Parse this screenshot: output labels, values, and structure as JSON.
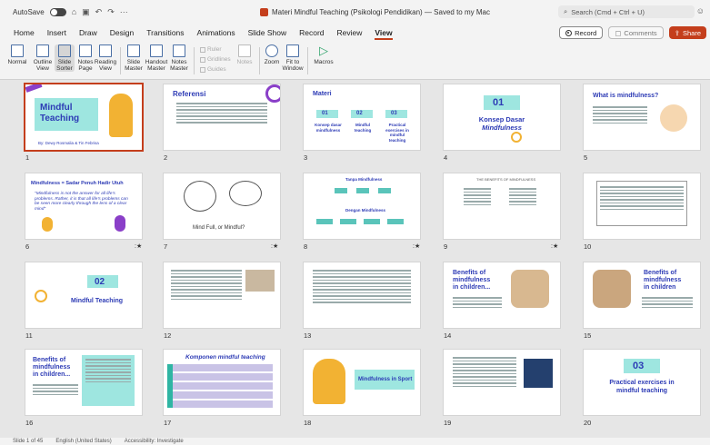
{
  "titlebar": {
    "autosave_label": "AutoSave",
    "document_title": "Materi Mindful Teaching (Psikologi Pendidikan) — Saved to my Mac",
    "search_placeholder": "Search (Cmd + Ctrl + U)"
  },
  "menu": {
    "tabs": [
      "Home",
      "Insert",
      "Draw",
      "Design",
      "Transitions",
      "Animations",
      "Slide Show",
      "Record",
      "Review",
      "View"
    ],
    "active_tab": "View",
    "record_label": "Record",
    "comments_label": "Comments",
    "share_label": "Share"
  },
  "ribbon": {
    "normal": "Normal",
    "outline_view": [
      "Outline",
      "View"
    ],
    "slide_sorter": [
      "Slide",
      "Sorter"
    ],
    "notes_page": [
      "Notes",
      "Page"
    ],
    "reading_view": [
      "Reading",
      "View"
    ],
    "slide_master": [
      "Slide",
      "Master"
    ],
    "handout_master": [
      "Handout",
      "Master"
    ],
    "notes_master": [
      "Notes",
      "Master"
    ],
    "ruler": "Ruler",
    "gridlines": "Gridlines",
    "guides": "Guides",
    "notes": "Notes",
    "zoom": "Zoom",
    "fit_to_window": [
      "Fit to",
      "Window"
    ],
    "macros": "Macros"
  },
  "slides": {
    "s1_title": [
      "Mindful",
      "Teaching"
    ],
    "s1_author": "By: Dewy Rosmalia & Tin Febrisa",
    "s2_title": "Referensi",
    "s3_title": "Materi",
    "s3_items": [
      "01",
      "02",
      "03"
    ],
    "s3_labels": [
      "Konsep dasar mindfulness",
      "Mindful teaching",
      "Practical exercises in mindful teaching"
    ],
    "s4_number": "01",
    "s4_title": [
      "Konsep Dasar",
      "Mindfulness"
    ],
    "s5_title": "What is mindfulness?",
    "s6_title": "Mindfulness = Sadar Penuh Hadir Utuh",
    "s6_quote": "\"Mindfulness is not the answer for all life's problems. Rather, it is that all life's problems can be seen more clearly through the lens of a clear mind\"",
    "s7_caption": "Mind Full, or Mindful?",
    "s8_title1": "Tanpa Mindfulness",
    "s8_title2": "Dengan Mindfulness",
    "s9_title": "THE BENEFITS OF MINDFULNESS",
    "s11_number": "02",
    "s11_title": "Mindful Teaching",
    "s14_title": [
      "Benefits of",
      "mindfulness",
      "in children..."
    ],
    "s15_title": [
      "Benefits of",
      "mindfulness",
      "in children"
    ],
    "s16_title": [
      "Benefits of",
      "mindfulness",
      "in children..."
    ],
    "s17_title": "Komponen mindful teaching",
    "s18_title": "Mindfulness in Sport",
    "s20_number": "03",
    "s20_title": [
      "Practical exercises in",
      "mindful teaching"
    ]
  },
  "slide_numbers": [
    "1",
    "2",
    "3",
    "4",
    "5",
    "6",
    "7",
    "8",
    "9",
    "10",
    "11",
    "12",
    "13",
    "14",
    "15",
    "16",
    "17",
    "18",
    "19",
    "20"
  ],
  "status": {
    "slide_of": "Slide 1 of 45",
    "language": "English (United States)",
    "accessibility": "Accessibility: Investigate"
  },
  "colors": {
    "accent": "#c43e1c",
    "slide_blue": "#2d3bb5",
    "slide_teal": "#9ee6e0",
    "slide_purple": "#8a3fc8",
    "slide_yellow": "#f2b233"
  }
}
